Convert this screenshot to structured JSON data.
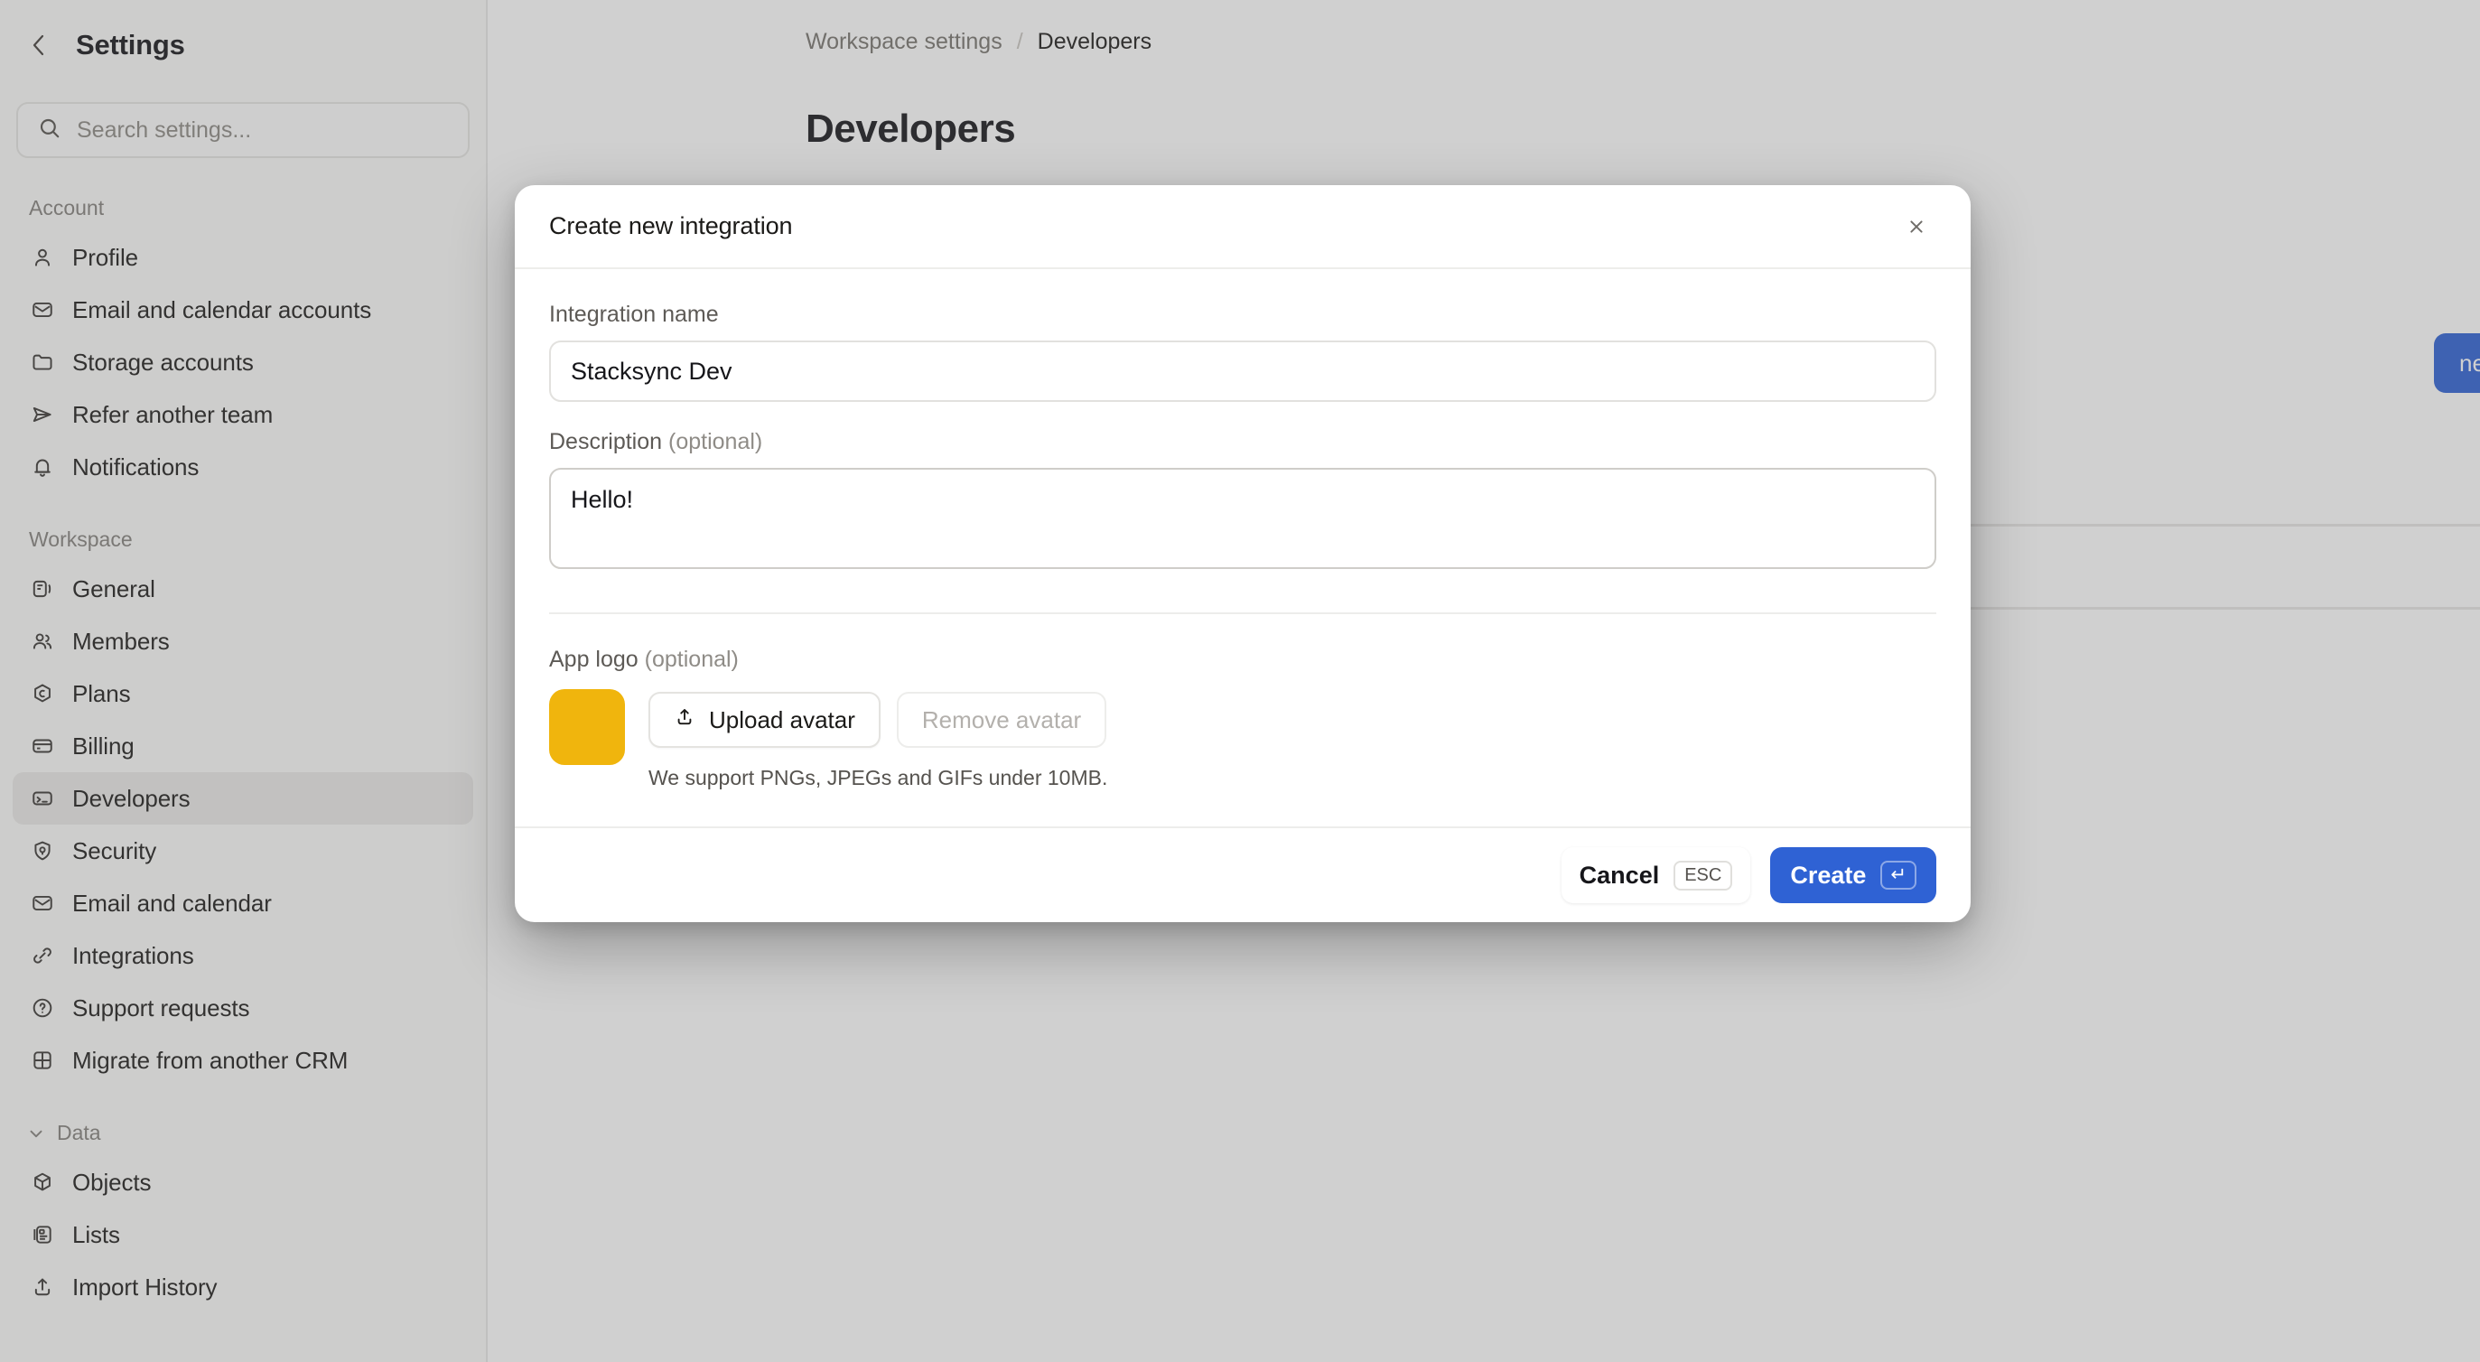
{
  "sidebar": {
    "title": "Settings",
    "back_icon": "chevron-left-icon",
    "search": {
      "icon": "search-icon",
      "placeholder": "Search settings..."
    },
    "groups": [
      {
        "label": "Account",
        "collapsible": false,
        "items": [
          {
            "label": "Profile",
            "icon": "user-icon"
          },
          {
            "label": "Email and calendar accounts",
            "icon": "envelope-icon"
          },
          {
            "label": "Storage accounts",
            "icon": "folder-icon"
          },
          {
            "label": "Refer another team",
            "icon": "send-icon"
          },
          {
            "label": "Notifications",
            "icon": "bell-icon"
          }
        ]
      },
      {
        "label": "Workspace",
        "collapsible": false,
        "items": [
          {
            "label": "General",
            "icon": "sliders-icon"
          },
          {
            "label": "Members",
            "icon": "users-icon"
          },
          {
            "label": "Plans",
            "icon": "plan-badge-icon"
          },
          {
            "label": "Billing",
            "icon": "credit-card-icon"
          },
          {
            "label": "Developers",
            "icon": "terminal-icon",
            "selected": true
          },
          {
            "label": "Security",
            "icon": "shield-icon"
          },
          {
            "label": "Email and calendar",
            "icon": "envelope-icon"
          },
          {
            "label": "Integrations",
            "icon": "link-icon"
          },
          {
            "label": "Support requests",
            "icon": "question-circle-icon"
          },
          {
            "label": "Migrate from another CRM",
            "icon": "grid-icon"
          }
        ]
      },
      {
        "label": "Data",
        "collapsible": true,
        "collapse_icon": "chevron-down-icon",
        "items": [
          {
            "label": "Objects",
            "icon": "cube-icon"
          },
          {
            "label": "Lists",
            "icon": "list-card-icon"
          },
          {
            "label": "Import History",
            "icon": "upload-icon"
          }
        ]
      }
    ]
  },
  "main": {
    "breadcrumb": {
      "parent": "Workspace settings",
      "separator": "/",
      "current": "Developers"
    },
    "page_title": "Developers",
    "create_button_label": "new integration"
  },
  "modal": {
    "title": "Create new integration",
    "close_icon": "close-icon",
    "fields": {
      "name_label": "Integration name",
      "name_value": "Stacksync Dev",
      "name_placeholder": "",
      "description_label": "Description",
      "description_optional": "(optional)",
      "description_value": "Hello!",
      "description_placeholder": "",
      "logo_label": "App logo",
      "logo_optional": "(optional)"
    },
    "avatar": {
      "color": "#f0b50d",
      "upload_label": "Upload avatar",
      "upload_icon": "upload-icon",
      "remove_label": "Remove avatar",
      "hint": "We support PNGs, JPEGs and GIFs under 10MB."
    },
    "footer": {
      "cancel_label": "Cancel",
      "cancel_shortcut": "ESC",
      "create_label": "Create",
      "create_shortcut": "↵"
    }
  },
  "colors": {
    "accent": "#2f62d4",
    "avatar": "#f0b50d",
    "sidebar_bg": "#fbfbfa",
    "selected_item": "#ebeae8"
  }
}
